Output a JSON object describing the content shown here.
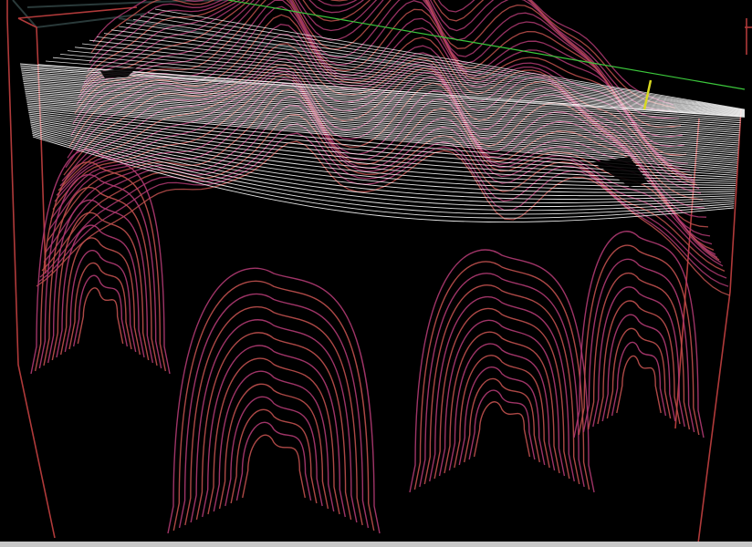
{
  "viewer": {
    "background": "#000000",
    "colors": {
      "surface_primary": "#b03a72",
      "surface_secondary": "#c0504e",
      "slice_plane": "#ffffff",
      "bounding_box": "#b03a3a",
      "axis_x": "#3cc83c",
      "axis_y": "#d8d820",
      "axis_z": "#9a3030",
      "frame_edge": "#2a3a3a",
      "status_bar": "#c8c8c8"
    },
    "objects": [
      {
        "name": "bounding-box",
        "type": "wireframe box"
      },
      {
        "name": "slice-plane",
        "type": "horizontal contour plane"
      },
      {
        "name": "isosurface-contours",
        "type": "stacked contour lines"
      },
      {
        "name": "axis-x",
        "type": "axis line"
      },
      {
        "name": "axis-y",
        "type": "axis marker"
      }
    ]
  }
}
